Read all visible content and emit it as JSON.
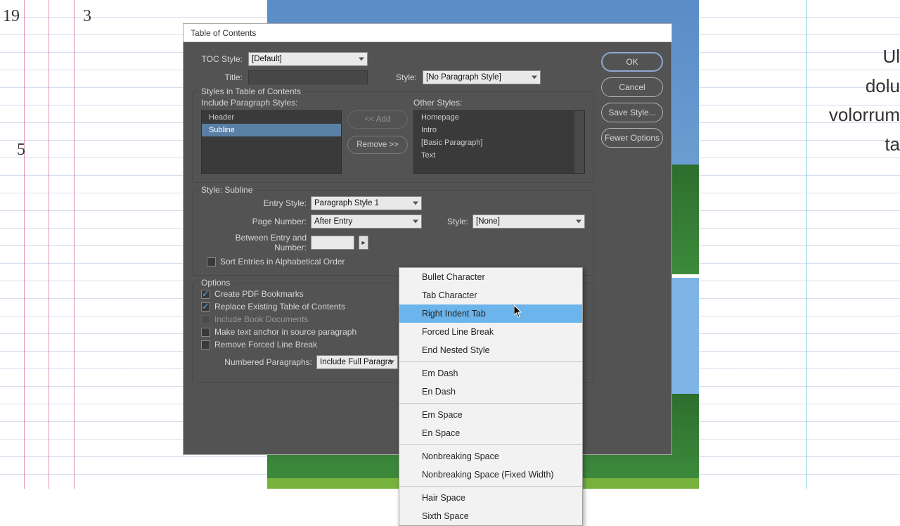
{
  "bg": {
    "num19": "19",
    "num3": "3",
    "num5": "5",
    "right_text_1": "Ul",
    "right_text_2": "dolu",
    "right_text_3": "volorrum",
    "right_text_4": "ta"
  },
  "dialog": {
    "title": "Table of Contents"
  },
  "top": {
    "toc_style_label": "TOC Style:",
    "toc_style_value": "[Default]",
    "title_label": "Title:",
    "title_value": "",
    "style_label": "Style:",
    "style_value": "[No Paragraph Style]"
  },
  "styles_group": {
    "title": "Styles in Table of Contents",
    "include_label": "Include Paragraph Styles:",
    "other_label": "Other Styles:",
    "include_items": [
      "Header",
      "Subline"
    ],
    "other_items": [
      "Homepage",
      "Intro",
      "[Basic Paragraph]",
      "Text"
    ],
    "add_btn": "<< Add",
    "remove_btn": "Remove >>"
  },
  "style_detail": {
    "title": "Style: Subline",
    "entry_style_label": "Entry Style:",
    "entry_style_value": "Paragraph Style 1",
    "page_number_label": "Page Number:",
    "page_number_value": "After Entry",
    "pn_style_label": "Style:",
    "pn_style_value": "[None]",
    "between_label": "Between Entry and Number:",
    "between_value": "",
    "sort_label": "Sort Entries in Alphabetical Order"
  },
  "options_group": {
    "title": "Options",
    "create_pdf": "Create PDF Bookmarks",
    "replace": "Replace Existing Table of Contents",
    "include_book": "Include Book Documents",
    "anchor": "Make text anchor in source paragraph",
    "remove_forced": "Remove Forced Line Break",
    "numbered_label": "Numbered Paragraphs:",
    "numbered_value": "Include Full Paragra"
  },
  "buttons": {
    "ok": "OK",
    "cancel": "Cancel",
    "save": "Save Style...",
    "fewer": "Fewer Options"
  },
  "popup": {
    "items": [
      "Bullet Character",
      "Tab Character",
      "Right Indent Tab",
      "Forced Line Break",
      "End Nested Style",
      "SEP",
      "Em Dash",
      "En Dash",
      "SEP",
      "Em Space",
      "En Space",
      "SEP",
      "Nonbreaking Space",
      "Nonbreaking Space (Fixed Width)",
      "SEP",
      "Hair Space",
      "Sixth Space"
    ],
    "highlight_index": 2
  }
}
